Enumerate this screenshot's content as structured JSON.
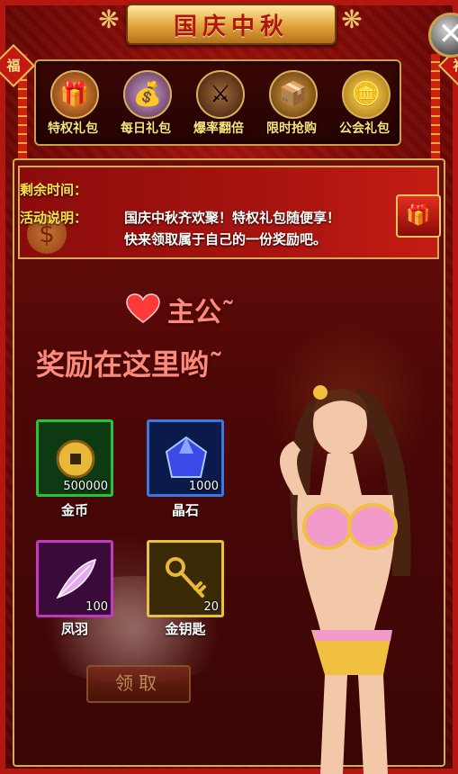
{
  "title": "国庆中秋",
  "fu_char": "福",
  "close_symbol": "✕",
  "tabs": [
    {
      "label": "特权礼包",
      "icon": "gift-box-icon",
      "glyph": "🎁"
    },
    {
      "label": "每日礼包",
      "icon": "treasure-bag-icon",
      "glyph": "💰"
    },
    {
      "label": "爆率翻倍",
      "icon": "warrior-icon",
      "glyph": "⚔"
    },
    {
      "label": "限时抢购",
      "icon": "treasure-chest-icon",
      "glyph": "📦"
    },
    {
      "label": "公会礼包",
      "icon": "gold-ingot-icon",
      "glyph": "🪙"
    }
  ],
  "info": {
    "remain_label": "剩余时间：",
    "desc_label": "活动说明：",
    "desc_line1": "国庆中秋齐欢聚！特权礼包随便享！",
    "desc_line2": "快来领取属于自己的一份奖励吧。"
  },
  "greeting": {
    "line1": "主公˜",
    "line2": "奖励在这里哟˜"
  },
  "rewards": [
    {
      "name": "金币",
      "quantity": "500000",
      "icon": "gold-coin-icon",
      "quality_color": "#28c23a"
    },
    {
      "name": "晶石",
      "quantity": "1000",
      "icon": "crystal-icon",
      "quality_color": "#3a7ae0"
    },
    {
      "name": "凤羽",
      "quantity": "100",
      "icon": "phoenix-feather-icon",
      "quality_color": "#c23ac2"
    },
    {
      "name": "金钥匙",
      "quantity": "20",
      "icon": "golden-key-icon",
      "quality_color": "#e8c23a"
    }
  ],
  "claim_button": "领取",
  "colors": {
    "accent_gold": "#d3ad55",
    "label_yellow": "#ffe24a",
    "greeting_pink": "#ff8a7a",
    "panel_red": "#6b0d0a"
  }
}
